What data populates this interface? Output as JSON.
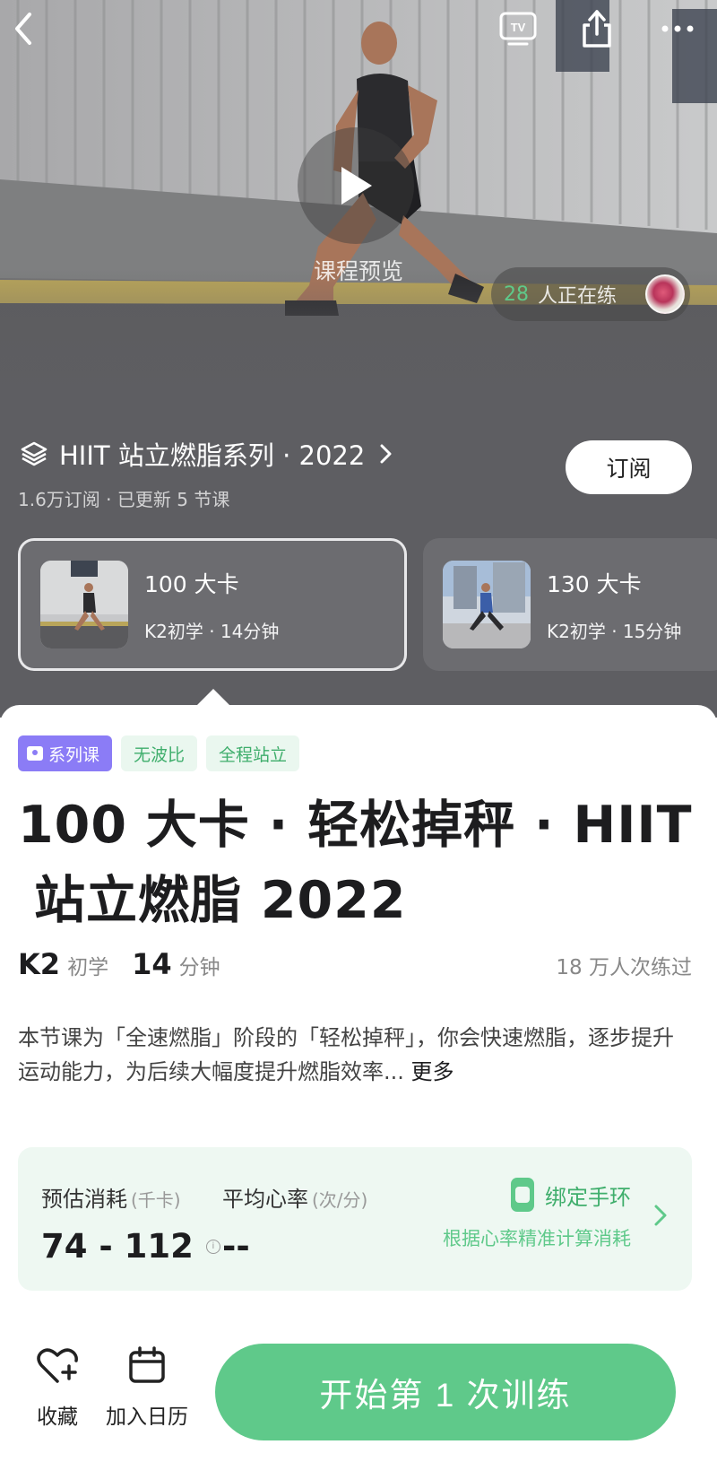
{
  "hero": {
    "preview_label": "课程预览",
    "practicing_count": "28",
    "practicing_text": "人正在练"
  },
  "series": {
    "title": "HIIT 站立燃脂系列 · 2022",
    "meta": "1.6万订阅 · 已更新 5 节课",
    "subscribe_label": "订阅"
  },
  "lessons": [
    {
      "kcal": "100 大卡",
      "meta": "K2初学 · 14分钟"
    },
    {
      "kcal": "130 大卡",
      "meta": "K2初学 · 15分钟"
    }
  ],
  "tags": [
    "系列课",
    "无波比",
    "全程站立"
  ],
  "course": {
    "title_line1": "100 大卡 · 轻松掉秤 · HIIT",
    "title_line2": "站立燃脂 2022",
    "level_value": "K2",
    "level_label": "初学",
    "duration_value": "14",
    "duration_label": "分钟",
    "practice_count": "18 万人次练过",
    "description": "本节课为「全速燃脂」阶段的「轻松掉秤」，你会快速燃脂，逐步提升运动能力，为后续大幅度提升燃脂效率...",
    "more_label": "更多"
  },
  "metrics": {
    "calories_label": "预估消耗",
    "calories_unit": "(千卡)",
    "calories_value": "74 - 112",
    "heart_label": "平均心率",
    "heart_unit": "(次/分)",
    "heart_value": "--",
    "bind_label": "绑定手环",
    "bind_sub": "根据心率精准计算消耗"
  },
  "bottom": {
    "favorite_label": "收藏",
    "calendar_label": "加入日历",
    "start_label": "开始第 1 次训练"
  },
  "colors": {
    "accent_green": "#5fc98a",
    "tag_purple": "#8b7cf6",
    "hero_gray": "#5e5e62"
  },
  "icons": [
    "back-icon",
    "tv-cast-icon",
    "share-icon",
    "more-icon",
    "play-icon",
    "layers-icon",
    "chevron-right-icon",
    "info-icon",
    "watch-icon",
    "heart-plus-icon",
    "calendar-icon"
  ]
}
